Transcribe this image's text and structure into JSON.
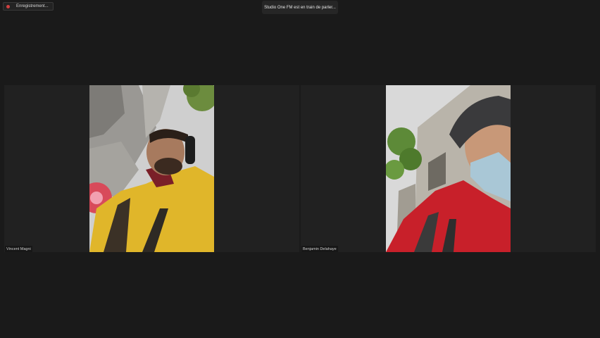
{
  "recording": {
    "label": "Enregistrement...",
    "icon": "record-dot-icon",
    "color": "#d04040"
  },
  "speaking_toast": {
    "text": "Studio One FM est en train de parler..."
  },
  "participants": [
    {
      "name": "Vincent Magni"
    },
    {
      "name": "Benjamin Delahaye"
    }
  ]
}
